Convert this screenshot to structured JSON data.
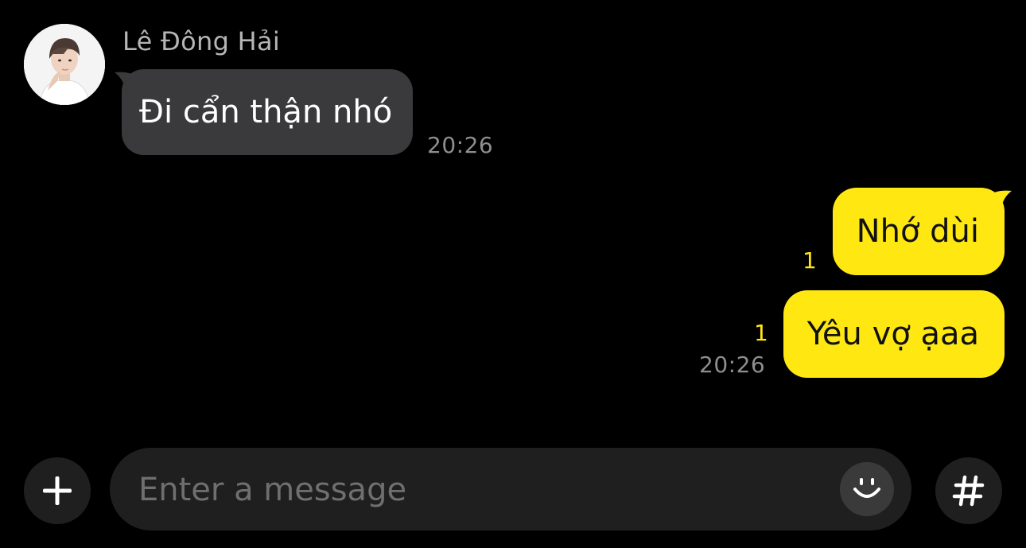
{
  "conversation": {
    "incoming": {
      "sender_name": "Lê Đông Hải",
      "avatar_icon": "person-avatar",
      "message": "Đi cẩn thận nhó",
      "time": "20:26",
      "bubble_color": "#3a3a3c"
    },
    "outgoing": [
      {
        "message": "Nhớ dùi",
        "unread_count": "1"
      },
      {
        "message": "Yêu vợ ạaa",
        "unread_count": "1",
        "time": "20:26"
      }
    ],
    "outgoing_bubble_color": "#ffe812"
  },
  "input_bar": {
    "placeholder": "Enter a message",
    "value": "",
    "left_button_icon": "plus-icon",
    "emoji_button_icon": "smiley-icon",
    "right_button_icon": "hashtag-icon"
  }
}
